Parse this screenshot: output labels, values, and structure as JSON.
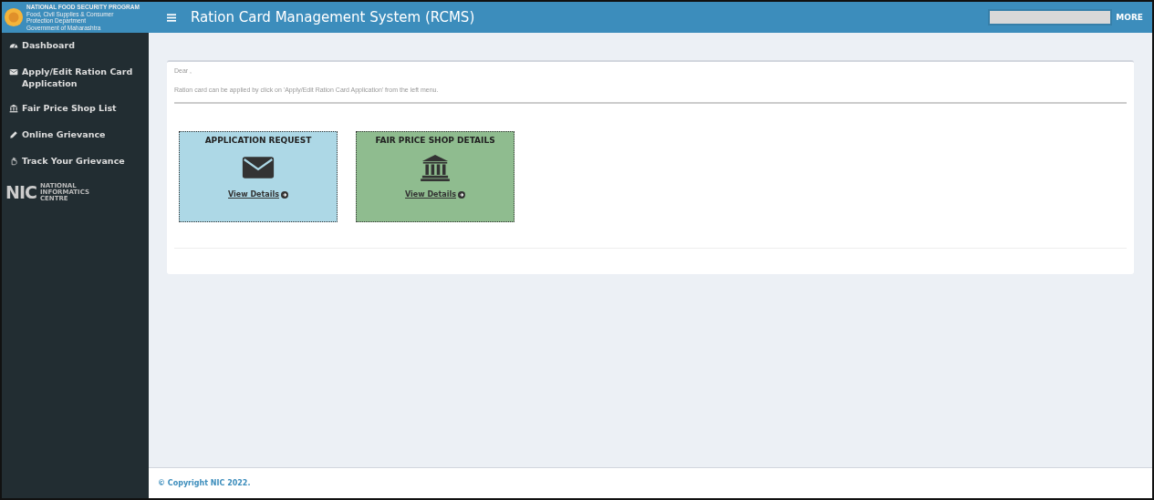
{
  "brand": {
    "lines": [
      "NATIONAL FOOD SECURITY PROGRAM",
      "Food, Civil Supplies & Consumer",
      "Protection Department",
      "Government of Maharashtra"
    ]
  },
  "header": {
    "title": "Ration Card Management System (RCMS)",
    "more": "MORE"
  },
  "sidebar": {
    "items": [
      {
        "label": "Dashboard",
        "kind": "dashboard"
      },
      {
        "label": "Apply/Edit Ration Card Application",
        "kind": "envelope"
      },
      {
        "label": "Fair Price Shop List",
        "kind": "bank"
      },
      {
        "label": "Online Grievance",
        "kind": "pencil"
      },
      {
        "label": "Track Your Grievance",
        "kind": "hand"
      }
    ],
    "logo": {
      "mark": "NIC",
      "lines": [
        "NATIONAL",
        "INFORMATICS",
        "CENTRE"
      ]
    }
  },
  "content": {
    "greeting": "Dear ,",
    "message": "Ration card can be applied by click on 'Apply/Edit Ration Card Application' from the left menu.",
    "cards": [
      {
        "title": "APPLICATION REQUEST",
        "kind": "envelope",
        "color": "#add8e6",
        "link": "View Details"
      },
      {
        "title": "FAIR PRICE SHOP DETAILS",
        "kind": "bank",
        "color": "#8fbc8f",
        "link": "View Details"
      }
    ]
  },
  "footer": {
    "text": "© Copyright NIC 2022."
  }
}
